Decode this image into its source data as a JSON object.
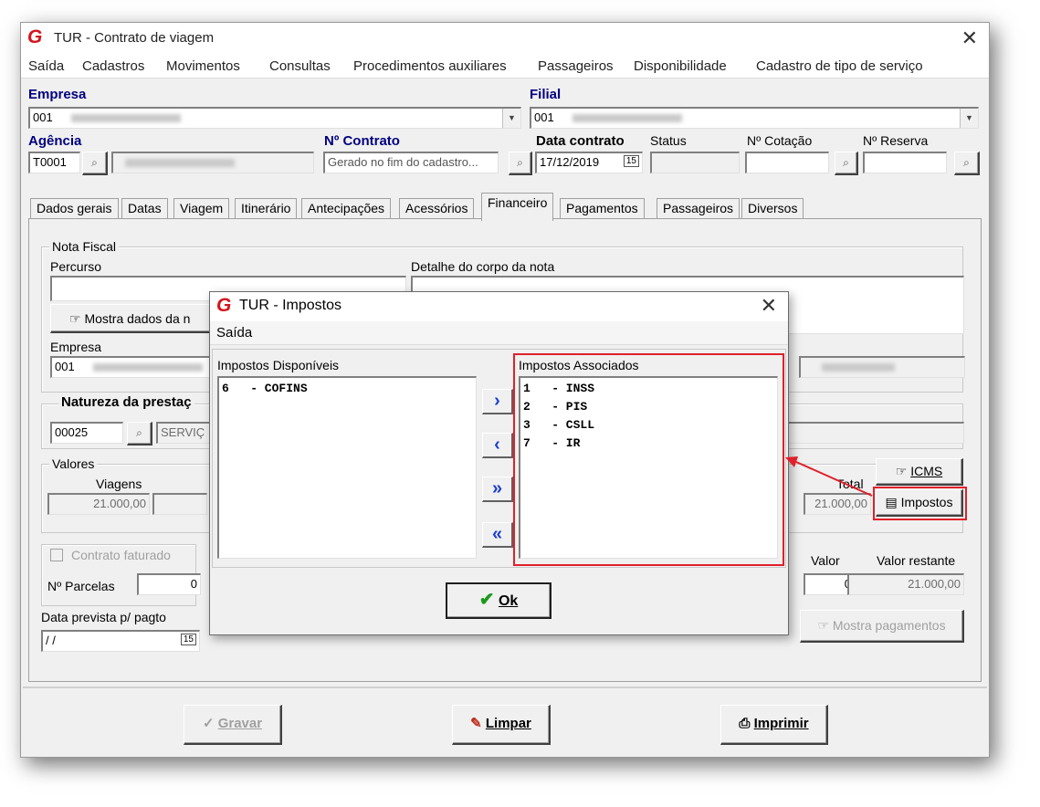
{
  "window": {
    "title": "TUR - Contrato de viagem",
    "close": "✕"
  },
  "menu": [
    "Saída",
    "Cadastros",
    "Movimentos",
    "Consultas",
    "Procedimentos auxiliares",
    "Passageiros",
    "Disponibilidade",
    "Cadastro de tipo de serviço"
  ],
  "header": {
    "empresa_label": "Empresa",
    "empresa_value": "001",
    "filial_label": "Filial",
    "filial_value": "001",
    "agencia_label": "Agência",
    "agencia_value": "T0001",
    "contrato_label": "Nº Contrato",
    "contrato_value": "Gerado no fim do cadastro...",
    "data_label": "Data contrato",
    "data_value": "17/12/2019",
    "calendar_label": "15",
    "status_label": "Status",
    "cotacao_label": "Nº Cotação",
    "reserva_label": "Nº Reserva"
  },
  "tabs": [
    "Dados gerais",
    "Datas",
    "Viagem",
    "Itinerário",
    "Antecipações",
    "Acessórios",
    "Financeiro",
    "Pagamentos",
    "Passageiros",
    "Diversos"
  ],
  "active_tab": "Financeiro",
  "financeiro": {
    "nota_fiscal_title": "Nota Fiscal",
    "percurso_label": "Percurso",
    "detalhe_label": "Detalhe do corpo da nota",
    "mostra_dados_label": "Mostra dados da n",
    "empresa_label": "Empresa",
    "empresa_value": "001",
    "natureza_title": "Natureza da prestaç",
    "natureza_code": "00025",
    "natureza_desc": "SERVIÇ",
    "valores_title": "Valores",
    "viagens_label": "Viagens",
    "viagens_value": "21.000,00",
    "total_label": "Total",
    "total_value": "21.000,00",
    "icms_button": "ICMS",
    "impostos_button": "Impostos",
    "contrato_faturado_label": "Contrato faturado",
    "parcelas_label": "Nº Parcelas",
    "parcelas_value": "0",
    "valor_label": "Valor",
    "valor_value": "0,00",
    "valor_restante_label": "Valor restante",
    "valor_restante_value": "21.000,00",
    "data_prevista_label": "Data prevista p/ pagto",
    "data_prevista_value": "/ /",
    "calendar_label": "15",
    "mostra_pagamentos_label": "Mostra pagamentos"
  },
  "bottom": {
    "gravar": "Gravar",
    "limpar": "Limpar",
    "imprimir": "Imprimir"
  },
  "dialog": {
    "title": "TUR - Impostos",
    "menu": "Saída",
    "disponiveis_label": "Impostos Disponíveis",
    "associados_label": "Impostos Associados",
    "disponiveis": [
      "6   - COFINS"
    ],
    "associados": [
      "1   - INSS",
      "2   - PIS",
      "3   - CSLL",
      "7   - IR"
    ],
    "ok_label": "Ok"
  },
  "colors": {
    "highlight": "#e0202a",
    "logo": "#d4141c",
    "arrow_blue": "#1f3fcf",
    "label_blue": "#000080"
  }
}
